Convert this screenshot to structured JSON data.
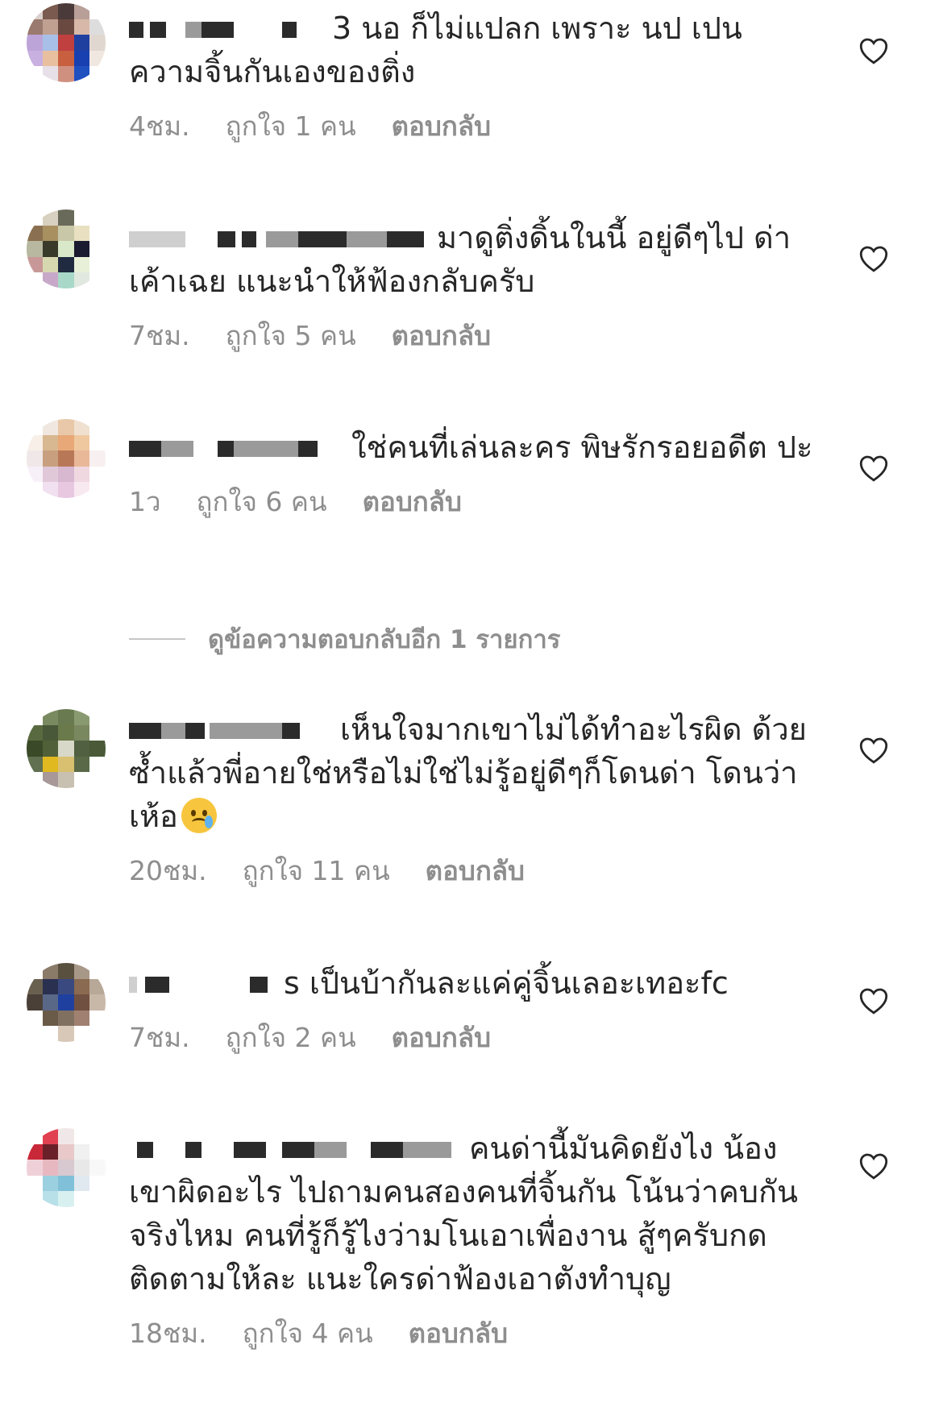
{
  "comments": [
    {
      "text": "3 นอ ก็ไม่แปลก  เพราะ  นป  เปน ความจิ้นกันเองของติ่ง",
      "time": "4ชม.",
      "likes": "ถูกใจ 1 คน",
      "reply": "ตอบกลับ"
    },
    {
      "text": "มาดูติ่งดิ้นในนี้ อยู่ดีๆไป ด่าเค้าเฉย แนะนำให้ฟ้องกลับครับ",
      "time": "7ชม.",
      "likes": "ถูกใจ 5 คน",
      "reply": "ตอบกลับ"
    },
    {
      "text": "ใช่คนที่เล่นละคร พิษรักรอยอดีต ปะ",
      "time": "1ว",
      "likes": "ถูกใจ 6 คน",
      "reply": "ตอบกลับ"
    },
    {
      "text": "เห็นใจมากเขาไม่ได้ทำอะไรผิด ด้วยซ้ำแล้วพี่อายใช่หรือไม่ใช่ไม่รู้อยู่ดีๆก็โดนด่า โดนว่าเห้อ",
      "time": "20ชม.",
      "likes": "ถูกใจ 11 คน",
      "reply": "ตอบกลับ"
    },
    {
      "text": "s เป็นบ้ากันละแค่คู่จิ้นเลอะเทอะfc",
      "time": "7ชม.",
      "likes": "ถูกใจ 2 คน",
      "reply": "ตอบกลับ"
    },
    {
      "text": "คนด่านี้มันคิดยังไง น้อง เขาผิดอะไร ไปถามคนสองคนที่จิ้นกัน โน้นว่าคบกัน จริงไหม คนที่รู้ก็รู้ไงว่ามโนเอาเพื่องาน สู้ๆครับกด ติดตามให้ละ แนะใครด่าฟ้องเอาตังทำบุญ",
      "time": "18ชม.",
      "likes": "ถูกใจ 4 คน",
      "reply": "ตอบกลับ"
    }
  ],
  "view_more": "ดูข้อความตอบกลับอีก 1 รายการ",
  "icons": {
    "heart": "heart-outline-icon",
    "emoji": "crying-face-emoji"
  },
  "colors": {
    "text": "#262626",
    "meta": "#8e8e8e"
  }
}
